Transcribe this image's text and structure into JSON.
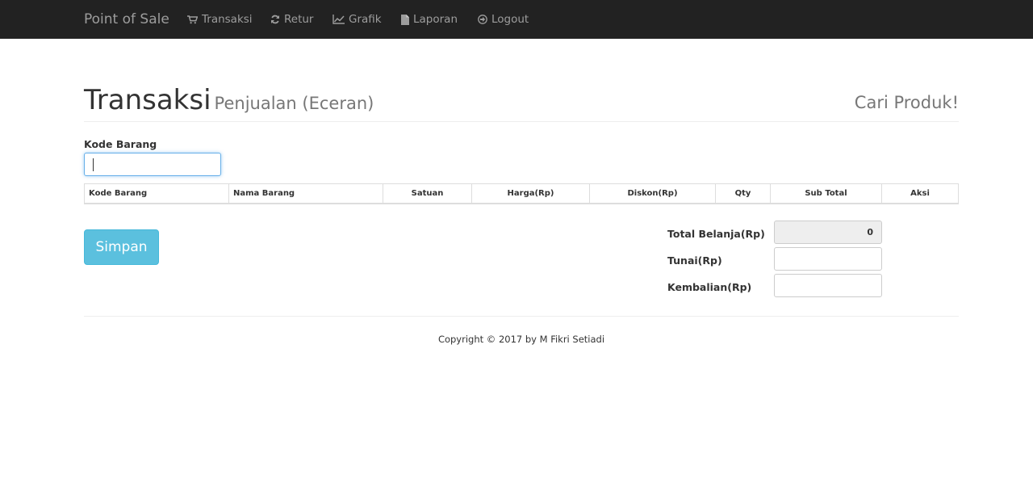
{
  "navbar": {
    "brand": "Point of Sale",
    "items": [
      {
        "label": "Transaksi",
        "icon": "cart-icon"
      },
      {
        "label": "Retur",
        "icon": "refresh-icon"
      },
      {
        "label": "Grafik",
        "icon": "line-chart-icon"
      },
      {
        "label": "Laporan",
        "icon": "file-icon"
      },
      {
        "label": "Logout",
        "icon": "logout-icon"
      }
    ]
  },
  "header": {
    "title": "Transaksi",
    "subtitle": "Penjualan (Eceran)",
    "search_link": "Cari Produk!"
  },
  "form": {
    "kode_label": "Kode Barang",
    "kode_value": ""
  },
  "table": {
    "columns": [
      "Kode Barang",
      "Nama Barang",
      "Satuan",
      "Harga(Rp)",
      "Diskon(Rp)",
      "Qty",
      "Sub Total",
      "Aksi"
    ],
    "rows": []
  },
  "actions": {
    "save_label": "Simpan"
  },
  "totals": {
    "total_belanja_label": "Total Belanja(Rp)",
    "total_belanja_value": "0",
    "tunai_label": "Tunai(Rp)",
    "tunai_value": "",
    "kembalian_label": "Kembalian(Rp)",
    "kembalian_value": ""
  },
  "footer": {
    "copyright": "Copyright © 2017 by M Fikri Setiadi"
  },
  "colors": {
    "navbar_bg": "#222222",
    "nav_text": "#9d9d9d",
    "button_info": "#5bc0de",
    "focus_border": "#66afe9"
  }
}
